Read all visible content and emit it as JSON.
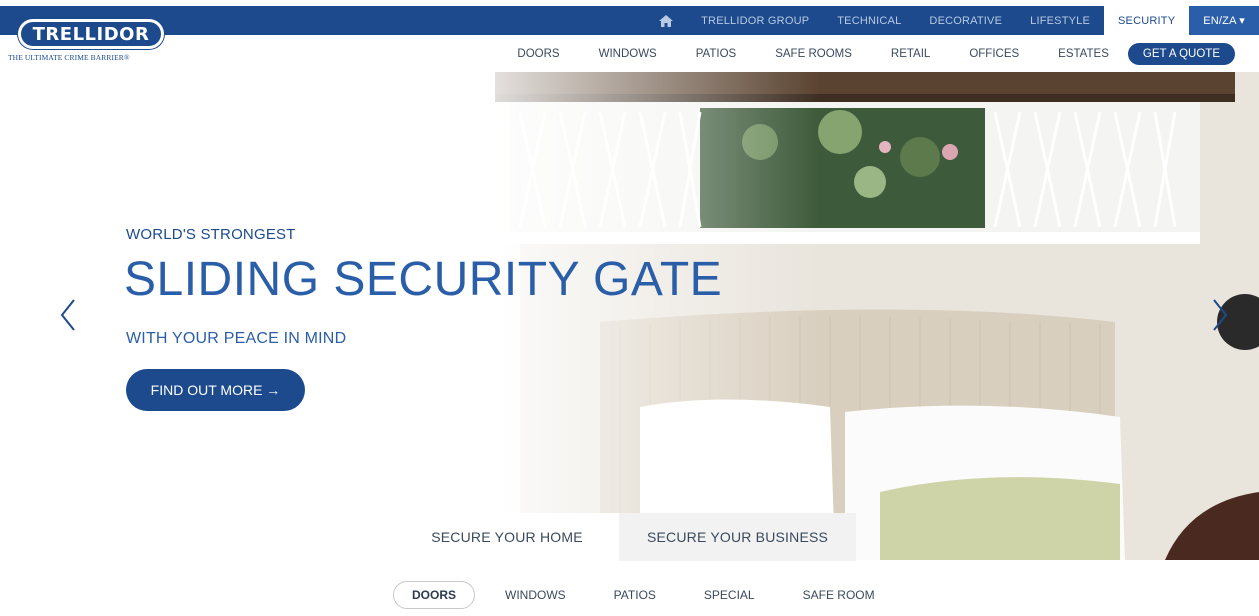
{
  "topnav": {
    "items": [
      "TRELLIDOR GROUP",
      "TECHNICAL",
      "DECORATIVE",
      "LIFESTYLE",
      "SECURITY"
    ],
    "active": "SECURITY",
    "language": "EN/ZA ▾"
  },
  "logo": {
    "name": "TRELLIDOR",
    "tagline": "THE ULTIMATE CRIME BARRIER®"
  },
  "subnav": {
    "items": [
      "DOORS",
      "WINDOWS",
      "PATIOS",
      "SAFE ROOMS",
      "RETAIL",
      "OFFICES",
      "ESTATES"
    ],
    "cta": "GET A QUOTE"
  },
  "hero": {
    "kicker": "WORLD'S STRONGEST",
    "title": "SLIDING SECURITY GATE",
    "subtitle": "WITH YOUR PEACE IN MIND",
    "button": "FIND OUT MORE →"
  },
  "tabs": {
    "home": "SECURE YOUR HOME",
    "business": "SECURE YOUR BUSINESS"
  },
  "pills": {
    "items": [
      "DOORS",
      "WINDOWS",
      "PATIOS",
      "SPECIAL",
      "SAFE ROOM"
    ],
    "active": "DOORS"
  },
  "colors": {
    "brand_blue": "#1c4a8c",
    "accent_blue": "#2a5ea8"
  }
}
